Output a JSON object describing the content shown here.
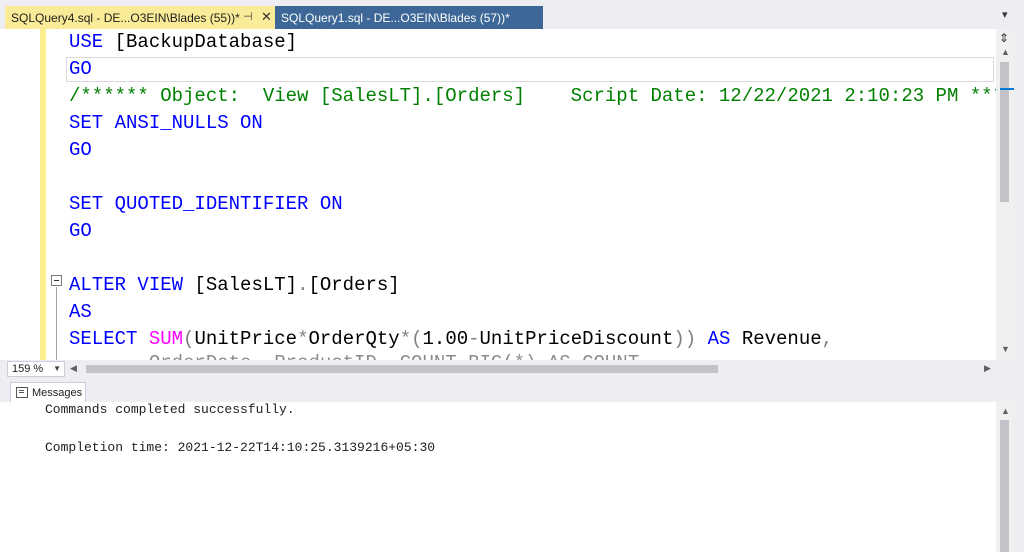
{
  "tabs": [
    {
      "label": "SQLQuery4.sql - DE...O3EIN\\Blades (55))*",
      "active": true
    },
    {
      "label": "SQLQuery1.sql - DE...O3EIN\\Blades (57))*",
      "active": false
    }
  ],
  "tab_controls": {
    "pin": "⊣",
    "close": "✕",
    "menu": "▾"
  },
  "code": {
    "line1_kw": "USE",
    "line1_rest": " [BackupDatabase]",
    "line2": "GO",
    "line3_comment": "/****** Object:  View [SalesLT].[Orders]    Script Date: 12/22/2021 2:10:23 PM ***",
    "line4_kw": "SET ANSI_NULLS ON",
    "line5": "GO",
    "line7_kw": "SET QUOTED_IDENTIFIER ON",
    "line8": "GO",
    "line10_kw": "ALTER VIEW",
    "line10_rest1": " [SalesLT]",
    "line10_dot": ".",
    "line10_rest2": "[Orders]",
    "line11": "AS",
    "line12_kw": "SELECT",
    "line12_fn": "SUM",
    "line12_p1": "(",
    "line12_a": "UnitPrice",
    "line12_s1": "*",
    "line12_b": "OrderQty",
    "line12_s2": "*",
    "line12_p2": "(",
    "line12_c": "1.00",
    "line12_m": "-",
    "line12_d": "UnitPriceDiscount",
    "line12_p3": "))",
    "line12_as": "AS",
    "line12_e": "Revenue",
    "line12_comma": ",",
    "line13_partial": "       OrderDate, ProductID, COUNT_BIG(*) AS COUNT"
  },
  "zoom": {
    "value": "159 %"
  },
  "results": {
    "tab_label": "Messages",
    "lines": [
      "Commands completed successfully.",
      "Completion time: 2021-12-22T14:10:25.3139216+05:30"
    ]
  },
  "colors": {
    "active_tab": "#f9eb97",
    "inactive_tab": "#3d6797",
    "keyword": "#0000ff",
    "comment": "#008000",
    "function": "#ff00ff"
  }
}
